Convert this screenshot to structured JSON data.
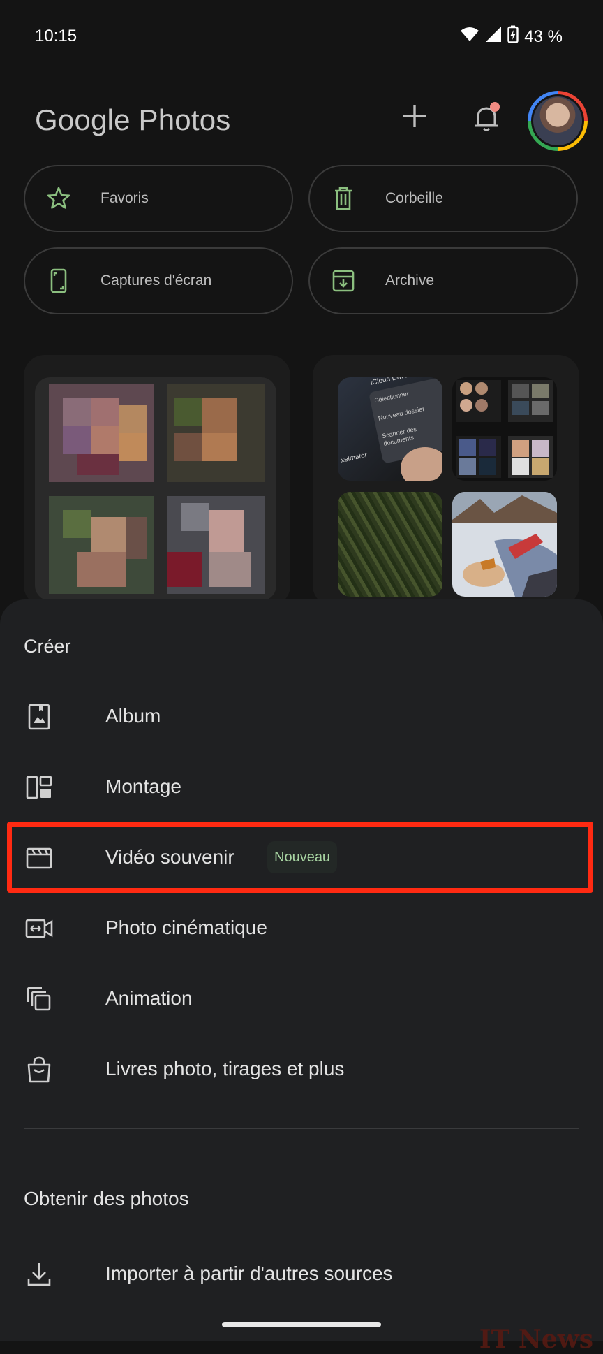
{
  "status_bar": {
    "time": "10:15",
    "battery_text": "43 %",
    "icons": [
      "wifi-icon",
      "signal-icon",
      "battery-charging-icon"
    ]
  },
  "header": {
    "app_title": "Google Photos",
    "icons": [
      "add-icon",
      "notifications-bell-icon"
    ],
    "notification_dot_color": "#f28b82"
  },
  "quick_actions": [
    {
      "label": "Favoris",
      "icon": "star-icon"
    },
    {
      "label": "Corbeille",
      "icon": "trash-icon"
    },
    {
      "label": "Captures d'écran",
      "icon": "screenshot-phone-icon"
    },
    {
      "label": "Archive",
      "icon": "archive-box-icon"
    }
  ],
  "accent_green": "#8bbf7f",
  "create_sheet": {
    "title": "Créer",
    "items": [
      {
        "label": "Album",
        "icon": "album-icon"
      },
      {
        "label": "Montage",
        "icon": "collage-icon"
      },
      {
        "label": "Vidéo souvenir",
        "icon": "clapperboard-icon",
        "badge": "Nouveau",
        "highlighted": true
      },
      {
        "label": "Photo cinématique",
        "icon": "cinematic-photo-icon"
      },
      {
        "label": "Animation",
        "icon": "animation-layers-icon"
      },
      {
        "label": "Livres photo, tirages et plus",
        "icon": "shopping-bag-icon"
      }
    ],
    "section2_title": "Obtenir des photos",
    "import_item": {
      "label": "Importer à partir d'autres sources",
      "icon": "download-icon"
    }
  },
  "thumbnail_texts": {
    "menu_title": "iCloud Drive",
    "menu_option_1": "Sélectionner",
    "menu_option_2": "Nouveau dossier",
    "menu_option_3": "Scanner des documents",
    "app_name": "xelmator"
  },
  "highlight_color": "#ff2a12",
  "watermark": "IT News"
}
